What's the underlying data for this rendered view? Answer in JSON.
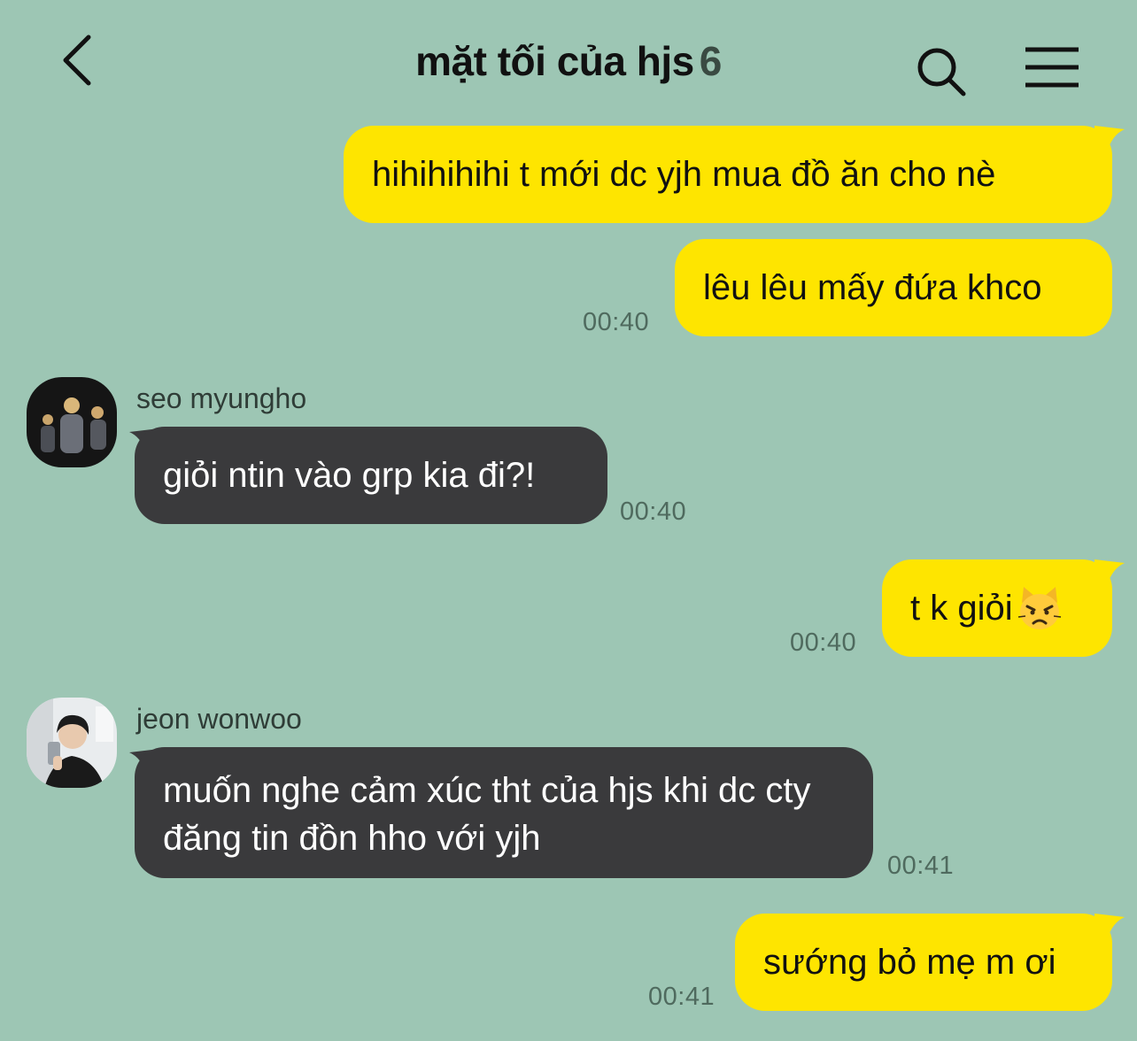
{
  "header": {
    "title": "mặt tối của hjs",
    "member_count": "6"
  },
  "messages": [
    {
      "from": "me",
      "text": "hihihihihi t mới dc yjh mua đồ ăn cho nè",
      "time": ""
    },
    {
      "from": "me",
      "text": "lêu lêu mấy đứa khco",
      "time": "00:40"
    },
    {
      "from": "seo myungho",
      "text": "giỏi ntin vào grp kia đi?!",
      "time": "00:40"
    },
    {
      "from": "me",
      "text": "t k giỏi",
      "emoji": "pouting-cat-emoji",
      "time": "00:40"
    },
    {
      "from": "jeon wonwoo",
      "text": "muốn nghe cảm xúc tht của hjs khi dc cty đăng tin đồn hho với yjh",
      "time": "00:41"
    },
    {
      "from": "me",
      "text": "sướng bỏ mẹ m ơi",
      "time": "00:41"
    }
  ],
  "senders": {
    "myungho": "seo myungho",
    "wonwoo": "jeon wonwoo"
  },
  "colors": {
    "background": "#9dc6b4",
    "my_bubble": "#fee500",
    "their_bubble": "#3a3a3c"
  },
  "icons": [
    "back-arrow-icon",
    "search-icon",
    "menu-icon",
    "pouting-cat-emoji"
  ]
}
